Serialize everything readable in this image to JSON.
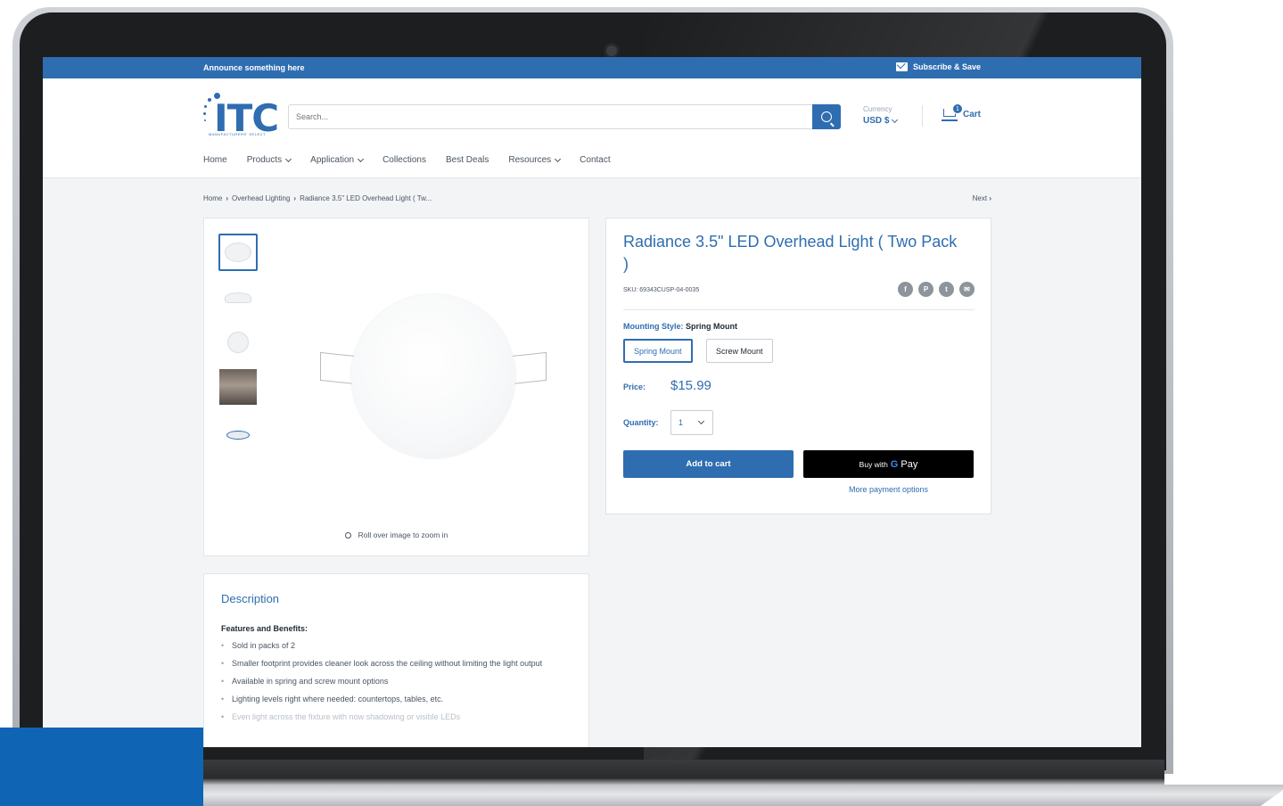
{
  "announce": {
    "text": "Announce something here",
    "subscribe_label": "Subscribe & Save"
  },
  "header": {
    "logo_text": "ITC",
    "logo_subtext": "MANUFACTURERS' SELECT",
    "search_placeholder": "Search...",
    "currency_label": "Currency",
    "currency_value": "USD $",
    "cart_label": "Cart",
    "cart_count": "1"
  },
  "nav": {
    "items": [
      {
        "label": "Home"
      },
      {
        "label": "Products"
      },
      {
        "label": "Application"
      },
      {
        "label": "Collections"
      },
      {
        "label": "Best Deals"
      },
      {
        "label": "Resources"
      },
      {
        "label": "Contact"
      }
    ]
  },
  "breadcrumb": {
    "items": [
      "Home",
      "Overhead Lighting",
      "Radiance 3.5\" LED Overhead Light ( Tw..."
    ],
    "next_label": "Next"
  },
  "gallery": {
    "zoom_hint": "Roll over image to zoom in"
  },
  "product": {
    "title": "Radiance 3.5\" LED Overhead Light ( Two Pack )",
    "sku": "SKU: 69343CUSP-04-0035",
    "mounting_label": "Mounting Style:",
    "mounting_value": "Spring Mount",
    "options": [
      "Spring Mount",
      "Screw Mount"
    ],
    "price_label": "Price:",
    "price_value": "$15.99",
    "quantity_label": "Quantity:",
    "quantity_value": "1",
    "add_to_cart": "Add to cart",
    "buy_with": "Buy with",
    "gpay_g": "G",
    "gpay_pay": "Pay",
    "more_payment": "More payment options"
  },
  "description": {
    "title": "Description",
    "subtitle": "Features and Benefits:",
    "bullets": [
      "Sold in packs of 2",
      "Smaller footprint provides cleaner look across the ceiling without limiting the light output",
      "Available in spring and screw mount options",
      "Lighting levels right where needed: countertops, tables, etc.",
      "Even light across the fixture with now shadowing or visible LEDs"
    ]
  },
  "colors": {
    "brand_blue": "#2f6db1",
    "accent_block": "#0f64b4"
  }
}
